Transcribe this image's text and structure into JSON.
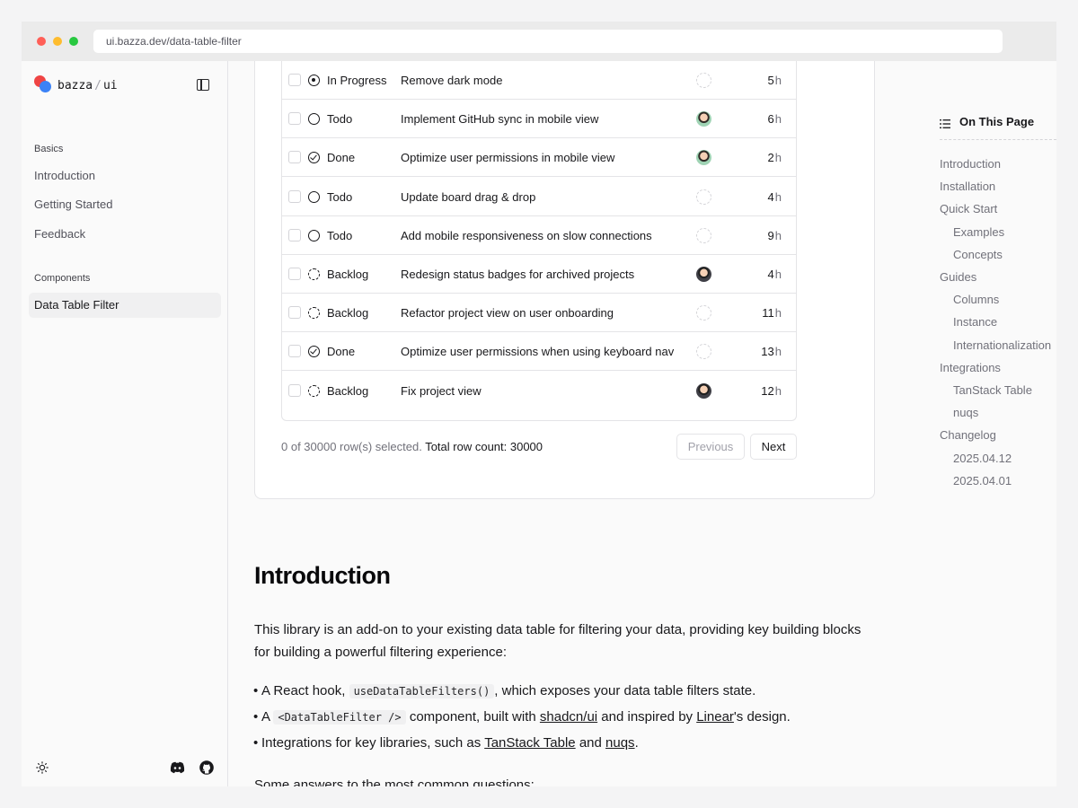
{
  "browser": {
    "url": "ui.bazza.dev/data-table-filter"
  },
  "sidebar": {
    "brand": "bazza",
    "brand_sep": "/",
    "brand_suffix": "ui",
    "groups": [
      {
        "label": "Basics",
        "items": [
          "Introduction",
          "Getting Started",
          "Feedback"
        ]
      },
      {
        "label": "Components",
        "items": [
          "Data Table Filter"
        ]
      }
    ],
    "active_item": "Data Table Filter"
  },
  "table": {
    "rows": [
      {
        "status": "In Progress",
        "title": "Remove dark mode",
        "assignee": "none",
        "estimate": "5",
        "unit": "h"
      },
      {
        "status": "Todo",
        "title": "Implement GitHub sync in mobile view",
        "assignee": "avatar-1",
        "estimate": "6",
        "unit": "h"
      },
      {
        "status": "Done",
        "title": "Optimize user permissions in mobile view",
        "assignee": "avatar-1",
        "estimate": "2",
        "unit": "h"
      },
      {
        "status": "Todo",
        "title": "Update board drag & drop",
        "assignee": "none",
        "estimate": "4",
        "unit": "h"
      },
      {
        "status": "Todo",
        "title": "Add mobile responsiveness on slow connections",
        "assignee": "none",
        "estimate": "9",
        "unit": "h"
      },
      {
        "status": "Backlog",
        "title": "Redesign status badges for archived projects",
        "assignee": "avatar-2",
        "estimate": "4",
        "unit": "h"
      },
      {
        "status": "Backlog",
        "title": "Refactor project view on user onboarding",
        "assignee": "none",
        "estimate": "11",
        "unit": "h"
      },
      {
        "status": "Done",
        "title": "Optimize user permissions when using keyboard nav",
        "assignee": "none",
        "estimate": "13",
        "unit": "h"
      },
      {
        "status": "Backlog",
        "title": "Fix project view",
        "assignee": "avatar-2",
        "estimate": "12",
        "unit": "h"
      }
    ],
    "selection_text": "0 of 30000 row(s) selected.",
    "total_text": "Total row count: 30000",
    "prev_label": "Previous",
    "next_label": "Next"
  },
  "content": {
    "heading": "Introduction",
    "paragraph": "This library is an add-on to your existing data table for filtering your data, providing key building blocks for building a powerful filtering experience:",
    "bullets": {
      "b1_pre": "A React hook,",
      "b1_code": "useDataTableFilters()",
      "b1_post": ", which exposes your data table filters state.",
      "b2_pre": "A",
      "b2_code": "<DataTableFilter />",
      "b2_mid": "component, built with",
      "b2_link1": "shadcn/ui",
      "b2_mid2": "and inspired by",
      "b2_link2": "Linear",
      "b2_post": "'s design.",
      "b3_pre": "Integrations for key libraries, such as",
      "b3_link1": "TanStack Table",
      "b3_mid": "and",
      "b3_link2": "nuqs",
      "b3_post": "."
    },
    "paragraph2": "Some answers to the most common questions:"
  },
  "toc": {
    "heading": "On This Page",
    "items": [
      {
        "label": "Introduction",
        "level": 1
      },
      {
        "label": "Installation",
        "level": 1
      },
      {
        "label": "Quick Start",
        "level": 1
      },
      {
        "label": "Examples",
        "level": 2
      },
      {
        "label": "Concepts",
        "level": 2
      },
      {
        "label": "Guides",
        "level": 1
      },
      {
        "label": "Columns",
        "level": 2
      },
      {
        "label": "Instance",
        "level": 2
      },
      {
        "label": "Internationalization",
        "level": 2
      },
      {
        "label": "Integrations",
        "level": 1
      },
      {
        "label": "TanStack Table",
        "level": 2
      },
      {
        "label": "nuqs",
        "level": 2
      },
      {
        "label": "Changelog",
        "level": 1
      },
      {
        "label": "2025.04.12",
        "level": 2
      },
      {
        "label": "2025.04.01",
        "level": 2
      }
    ]
  }
}
